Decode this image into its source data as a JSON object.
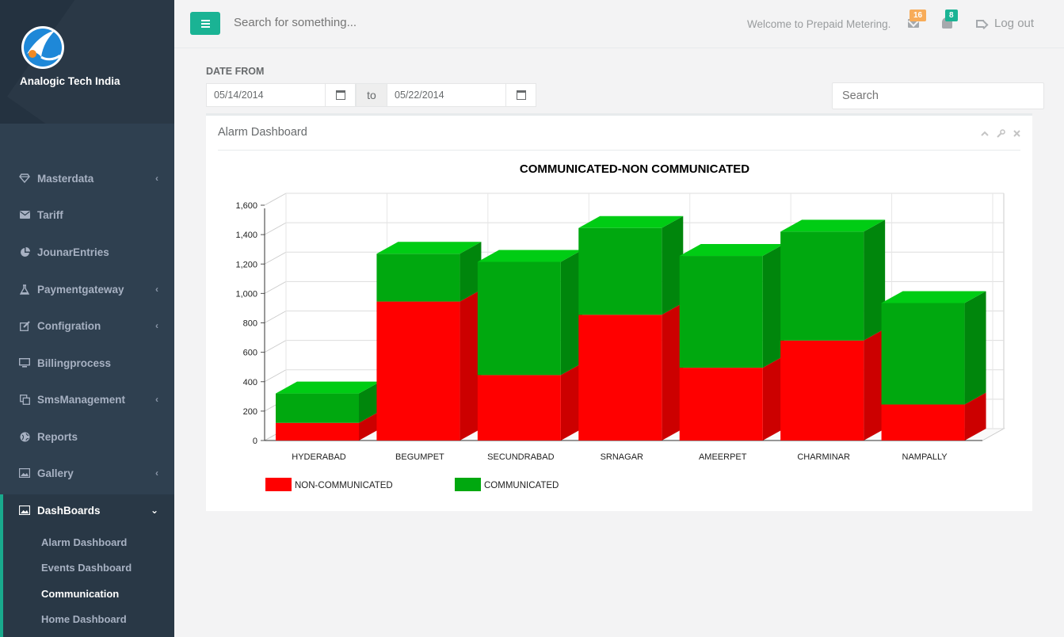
{
  "brand": {
    "name": "Analogic Tech India",
    "logo_icon": "globe-logo-icon"
  },
  "sidebar": {
    "items": [
      {
        "label": "Masterdata",
        "icon": "diamond-icon",
        "arrow": "‹"
      },
      {
        "label": "Tariff",
        "icon": "envelope-icon",
        "arrow": ""
      },
      {
        "label": "JounarEntries",
        "icon": "pie-chart-icon",
        "arrow": ""
      },
      {
        "label": "Paymentgateway",
        "icon": "flask-icon",
        "arrow": "‹"
      },
      {
        "label": "Configration",
        "icon": "edit-icon",
        "arrow": "‹"
      },
      {
        "label": "Billingprocess",
        "icon": "desktop-icon",
        "arrow": ""
      },
      {
        "label": "SmsManagement",
        "icon": "copy-icon",
        "arrow": "‹"
      },
      {
        "label": "Reports",
        "icon": "globe-icon",
        "arrow": ""
      },
      {
        "label": "Gallery",
        "icon": "picture-icon",
        "arrow": "‹"
      }
    ],
    "active": {
      "label": "DashBoards",
      "icon": "picture-icon",
      "arrow": "⌄"
    },
    "subitems": [
      "Alarm Dashboard",
      "Events Dashboard",
      "Communication",
      "Home Dashboard"
    ],
    "current_subitem": "Communication"
  },
  "topbar": {
    "search_placeholder": "Search for something...",
    "welcome": "Welcome to Prepaid Metering.",
    "mail_count": "16",
    "alert_count": "8",
    "logout": "Log out"
  },
  "filters": {
    "date_from_label": "DATE FROM",
    "from_value": "05/14/2014",
    "to_label": "to",
    "to_value": "05/22/2014",
    "search_placeholder": "Search"
  },
  "panel": {
    "title": "Alarm Dashboard"
  },
  "colors": {
    "accent": "#1ab394",
    "sidebar": "#2f4050",
    "red": "#ff0000",
    "green": "#00a80f"
  },
  "chart_data": {
    "type": "bar",
    "stacked": true,
    "title": "COMMUNICATED-NON COMMUNICATED",
    "categories": [
      "HYDERABAD",
      "BEGUMPET",
      "SECUNDRABAD",
      "SRNAGAR",
      "AMEERPET",
      "CHARMINAR",
      "NAMPALLY"
    ],
    "series": [
      {
        "name": "NON-COMMUNICATED",
        "color": "#ff0000",
        "values": [
          120,
          945,
          445,
          855,
          495,
          680,
          245
        ]
      },
      {
        "name": "COMMUNICATED",
        "color": "#00a80f",
        "values": [
          200,
          325,
          770,
          590,
          760,
          740,
          690
        ]
      }
    ],
    "ylim": [
      0,
      1600
    ],
    "yticks": [
      "0",
      "200",
      "400",
      "600",
      "800",
      "1,000",
      "1,200",
      "1,400",
      "1,600"
    ],
    "legend_position": "bottom-left",
    "grid": true
  }
}
